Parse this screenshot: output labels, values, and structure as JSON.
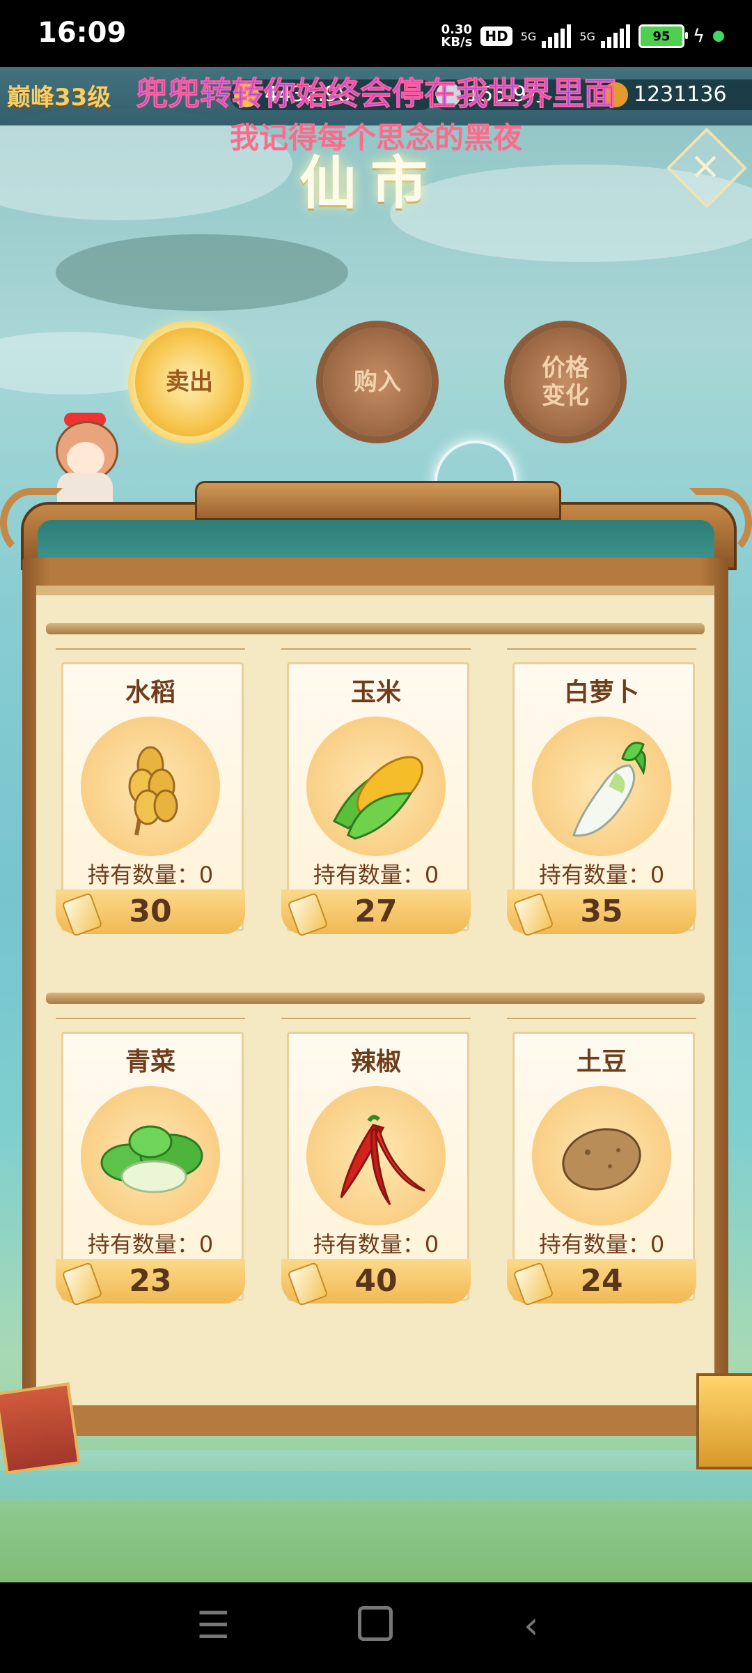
{
  "status_bar": {
    "time": "16:09",
    "net_speed_value": "0.30",
    "net_speed_unit": "KB/s",
    "hd_badge": "HD",
    "signal1_label": "5G",
    "signal2_label": "5G",
    "battery": "95"
  },
  "resource_bar": {
    "level": "巅峰33级",
    "res1_value": "4432.98",
    "res2_value": "155.9万",
    "res3_value": "1231136"
  },
  "lyrics": {
    "line1": "兜兜转转你始终会停在我世界里面",
    "line2": "我记得每个思念的黑夜"
  },
  "page_title": "仙市",
  "tabs": {
    "sell": "卖出",
    "buy": "购入",
    "price_change_line1": "价格",
    "price_change_line2": "变化"
  },
  "items": [
    {
      "name": "水稻",
      "owned": "持有数量：0",
      "price": "30",
      "icon": "rice-icon"
    },
    {
      "name": "玉米",
      "owned": "持有数量：0",
      "price": "27",
      "icon": "corn-icon"
    },
    {
      "name": "白萝卜",
      "owned": "持有数量：0",
      "price": "35",
      "icon": "radish-icon"
    },
    {
      "name": "青菜",
      "owned": "持有数量：0",
      "price": "23",
      "icon": "bok-choy-icon"
    },
    {
      "name": "辣椒",
      "owned": "持有数量：0",
      "price": "40",
      "icon": "chili-icon"
    },
    {
      "name": "土豆",
      "owned": "持有数量：0",
      "price": "24",
      "icon": "potato-icon"
    }
  ],
  "colors": {
    "accent_gold": "#f7c54c",
    "frame_brown": "#b57a40",
    "panel_cream": "#f5e9c3",
    "text_brown": "#6e3d1c"
  }
}
